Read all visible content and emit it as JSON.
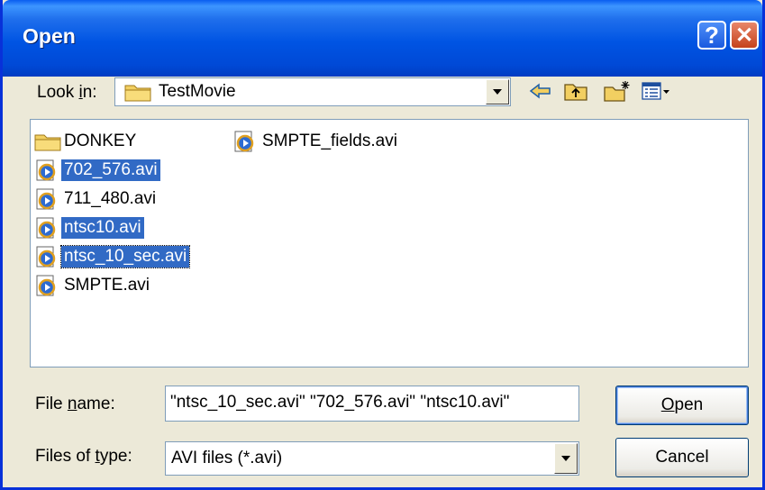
{
  "window": {
    "title": "Open",
    "help_label": "?",
    "close_label": "✕"
  },
  "look_in": {
    "label_pre": "Look ",
    "label_key": "i",
    "label_post": "n:",
    "value": "TestMovie"
  },
  "toolbar": {
    "icons": [
      "back-arrow-icon",
      "up-one-level-icon",
      "new-folder-icon",
      "view-menu-icon"
    ]
  },
  "files": {
    "column1": [
      {
        "name": "DONKEY",
        "type": "folder",
        "selected": false,
        "focused": false
      },
      {
        "name": "702_576.avi",
        "type": "avi",
        "selected": true,
        "focused": false
      },
      {
        "name": "711_480.avi",
        "type": "avi",
        "selected": false,
        "focused": false
      },
      {
        "name": "ntsc10.avi",
        "type": "avi",
        "selected": true,
        "focused": false
      },
      {
        "name": "ntsc_10_sec.avi",
        "type": "avi",
        "selected": true,
        "focused": true
      },
      {
        "name": "SMPTE.avi",
        "type": "avi",
        "selected": false,
        "focused": false
      }
    ],
    "column2": [
      {
        "name": "SMPTE_fields.avi",
        "type": "avi",
        "selected": false,
        "focused": false
      }
    ]
  },
  "file_name": {
    "label_pre": "File ",
    "label_key": "n",
    "label_post": "ame:",
    "value": "\"ntsc_10_sec.avi\" \"702_576.avi\" \"ntsc10.avi\""
  },
  "file_type": {
    "label_pre": "Files of ",
    "label_key": "t",
    "label_post": "ype:",
    "value": "AVI files (*.avi)"
  },
  "buttons": {
    "open_key": "O",
    "open_rest": "pen",
    "cancel": "Cancel"
  },
  "colors": {
    "titlebar": "#0054e3",
    "selection": "#316ac5",
    "face": "#ece9d8",
    "folder": "#f2cf61"
  }
}
